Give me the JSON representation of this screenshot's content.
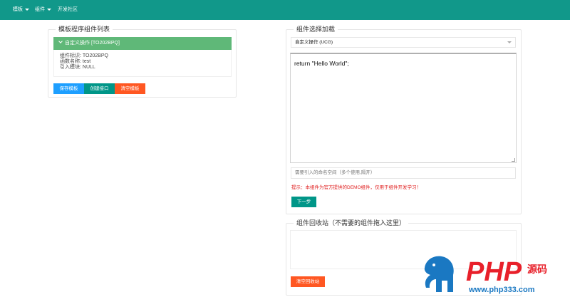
{
  "nav": {
    "items": [
      {
        "label": "模板",
        "has_dropdown": true
      },
      {
        "label": "组件",
        "has_dropdown": true
      },
      {
        "label": "开发社区",
        "has_dropdown": false
      }
    ]
  },
  "template_panel": {
    "title": "模板程序组件列表",
    "component": {
      "header": "自定义操作 [TO202BPQ]",
      "expanded": true,
      "details": [
        "组件标识: TO202BPQ",
        "函数名称: test",
        "引入模块: NULL"
      ]
    },
    "buttons": {
      "save": "保存模板",
      "create_api": "创建接口",
      "clear": "清空模板"
    }
  },
  "component_panel": {
    "title": "组件选择加载",
    "select_value": "自定义操作 (UCG)",
    "code": "return \"Hello World\";",
    "namespace_placeholder": "需要引入的命名空间（多个使用,隔开）",
    "tip": "提示：本组件为官方提供的DEMO组件，仅用于组件开发学习！",
    "next_button": "下一步"
  },
  "recycle_panel": {
    "title": "组件回收站（不需要的组件拖入这里）",
    "clear_button": "清空回收站"
  },
  "watermark": {
    "brand": "PHP",
    "brand_suffix": "源码",
    "url": "www.php333.com"
  },
  "colors": {
    "topbar": "#11988a",
    "accordion": "#5fb878",
    "blue_button": "#1e9fff",
    "green_button": "#009688",
    "orange_button": "#ff5722",
    "tip_text": "#e02020",
    "watermark_red": "#e8202a",
    "watermark_blue": "#1a78c2"
  }
}
